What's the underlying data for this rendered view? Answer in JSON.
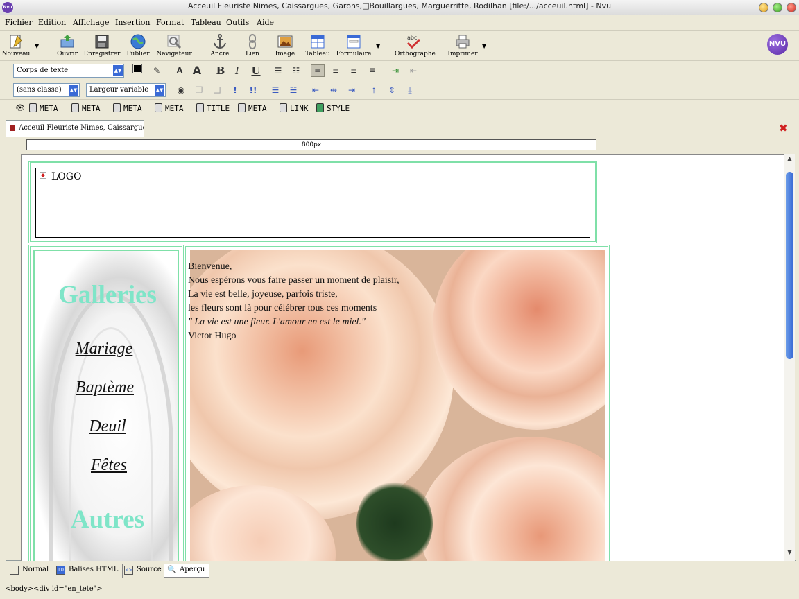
{
  "window": {
    "title": "Acceuil Fleuriste Nimes, Caissargues, Garons,□Bouillargues, Marguerritte, Rodilhan [file:/.../acceuil.html] - Nvu",
    "app_icon": "Nvu"
  },
  "menu": [
    "Fichier",
    "Edition",
    "Affichage",
    "Insertion",
    "Format",
    "Tableau",
    "Outils",
    "Aide"
  ],
  "toolbar": {
    "new": "Nouveau",
    "open": "Ouvrir",
    "save": "Enregistrer",
    "publish": "Publier",
    "browse": "Navigateur",
    "anchor": "Ancre",
    "link": "Lien",
    "image": "Image",
    "table": "Tableau",
    "form": "Formulaire",
    "spell": "Orthographe",
    "print": "Imprimer",
    "logo": "NVU"
  },
  "format": {
    "paragraph_style": "Corps de texte",
    "class": "(sans classe)",
    "width": "Largeur variable",
    "bold": "B",
    "italic": "I",
    "underline": "U",
    "font_smaller": "A",
    "font_larger": "A",
    "text_color": "#000000"
  },
  "tags": [
    "META",
    "META",
    "META",
    "META",
    "TITLE",
    "META",
    "LINK",
    "STYLE"
  ],
  "document_tab": "Acceuil Fleuriste Nimes, Caissargues...",
  "ruler": "800px",
  "page": {
    "logo": "LOGO",
    "galleries_title": "Galleries",
    "links": [
      "Mariage",
      "Baptème",
      "Deuil",
      "Fêtes"
    ],
    "autres": "Autres",
    "welcome_lines": [
      "Bienvenue,",
      "Nous espérons vous faire passer un moment de plaisir,",
      "La vie est belle, joyeuse, parfois triste,",
      "les fleurs sont là pour célébrer tous ces moments"
    ],
    "quote": "\" La vie est une fleur. L'amour en est le miel.\"",
    "author": "Victor Hugo"
  },
  "view_tabs": [
    "Normal",
    "Balises HTML",
    "Source",
    "Aperçu"
  ],
  "status": {
    "body": "<body>",
    "div": "<div id=\"en_tete\">"
  },
  "colors": {
    "accent_green": "#7fe0a8",
    "gallery_title": "#7fe5c8",
    "rose": "#f3c3a8"
  }
}
